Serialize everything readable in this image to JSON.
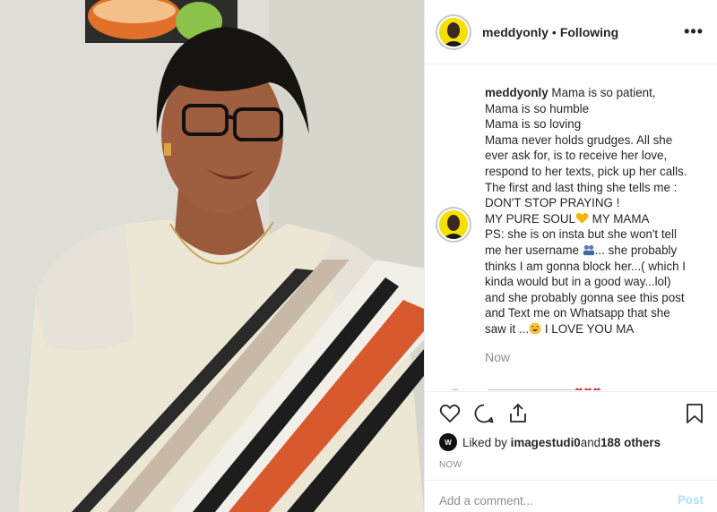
{
  "post": {
    "username": "meddyonly",
    "separator": "•",
    "follow_status": "Following",
    "more_label": "•••"
  },
  "caption": {
    "username": "meddyonly",
    "first_line": "Mama is so patient,",
    "lines": [
      "Mama is so humble",
      "Mama is so loving",
      "Mama never holds grudges. All she",
      "ever ask for, is to receive her love,",
      "respond to her texts, pick up her calls.",
      "The first and last thing she tells me :",
      "DON'T STOP PRAYING !"
    ],
    "pure_soul_a": "MY PURE SOUL",
    "pure_soul_b": " MY MAMA",
    "ps_line": "PS: she is on insta but she won't tell",
    "username_line_a": "me her username ",
    "username_line_b": "... she probably",
    "more_lines": [
      "thinks I am gonna block her...( which I",
      "kinda would but in a good way...lol)",
      "and she probably gonna see this post",
      "and Text me on Whatsapp that she"
    ],
    "last_line_a": "saw it ...",
    "last_line_b": " I LOVE YOU MA",
    "time": "Now"
  },
  "likes": {
    "prefix": "Liked by ",
    "user": "imagestudi0",
    "middle": " and ",
    "others": "188 others",
    "avatar_text": "W"
  },
  "timestamp": "NOW",
  "comment": {
    "placeholder": "Add a comment...",
    "post_label": "Post"
  },
  "icons": {
    "like": "heart-outline-icon",
    "comment": "comment-bubble-icon",
    "share": "share-arrow-icon",
    "save": "bookmark-icon",
    "more": "more-options-icon"
  },
  "colors": {
    "text": "#262626",
    "muted": "#8e8e8e",
    "border": "#efefef",
    "post_button_disabled": "#b2dffc",
    "heart_emoji": "#f4b400",
    "avatar_bg": "#f6e000"
  }
}
